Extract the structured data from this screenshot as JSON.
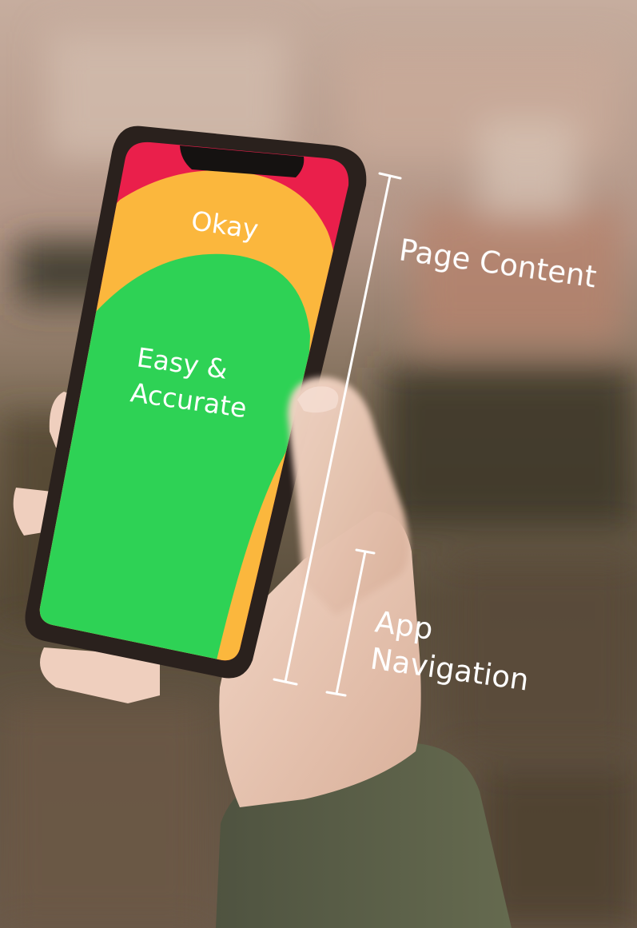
{
  "photo": {
    "description_free": true,
    "colors": {
      "wall_light": "#b79d8e",
      "wall_dark": "#4d4433",
      "phone_body": "#2a211d",
      "screen_red": "#ea1f4b",
      "screen_yellow": "#fbb73d",
      "screen_green": "#2ed255",
      "skin": "#eccdbd",
      "sleeve": "#5a5e46",
      "annotation": "#ffffff"
    }
  },
  "screen": {
    "zones": {
      "okay": "Okay",
      "easy": "Easy &",
      "accurate": "Accurate"
    }
  },
  "annotations": {
    "page_content": "Page Content",
    "app_line1": "App",
    "app_line2": "Navigation"
  }
}
